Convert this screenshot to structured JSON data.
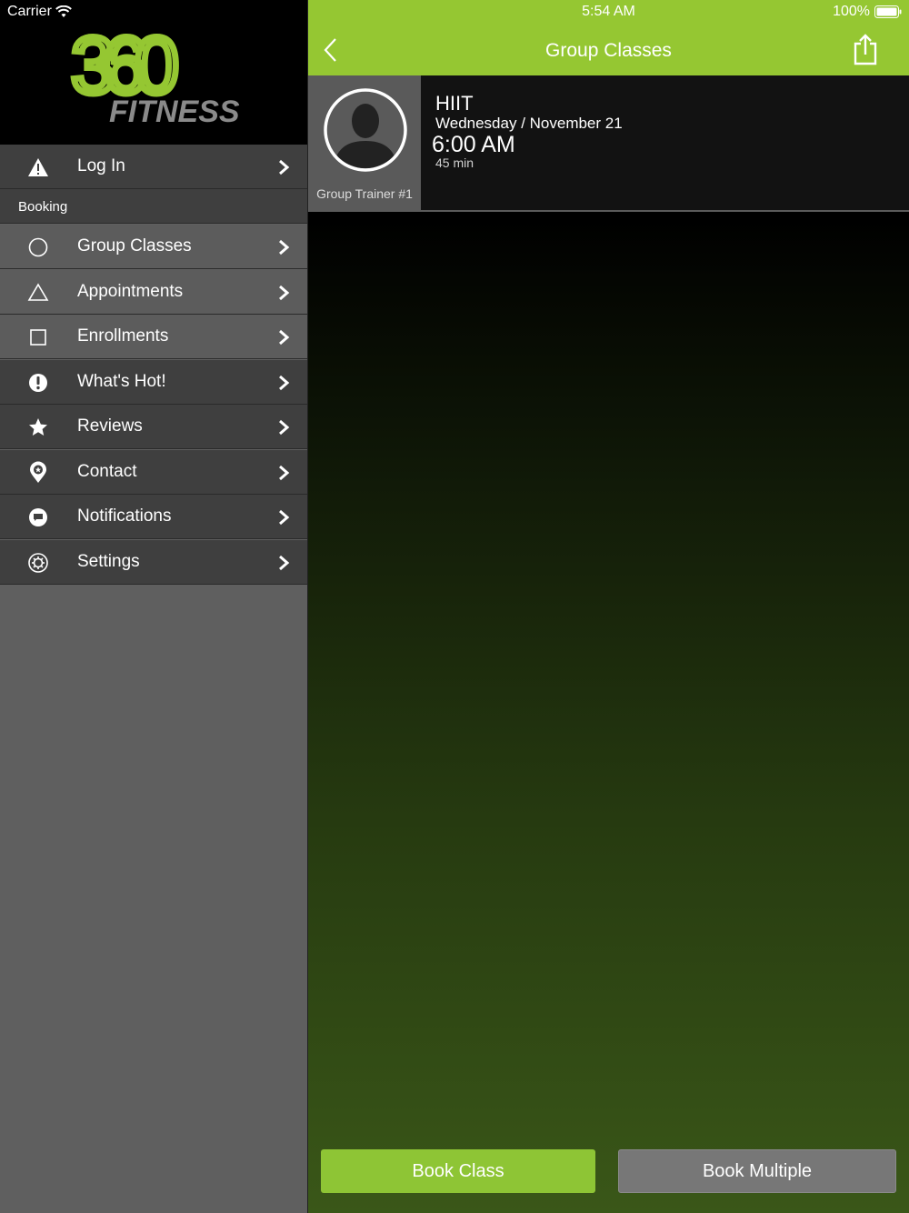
{
  "status_bar": {
    "carrier": "Carrier",
    "time": "5:54 AM",
    "battery": "100%"
  },
  "sidebar": {
    "logo_text_top": "360",
    "logo_text_bottom": "FITNESS",
    "login": {
      "label": "Log In",
      "icon": "warning-icon"
    },
    "section_header": "Booking",
    "items": [
      {
        "label": "Group Classes",
        "icon": "circle-icon"
      },
      {
        "label": "Appointments",
        "icon": "triangle-icon"
      },
      {
        "label": "Enrollments",
        "icon": "square-icon"
      },
      {
        "label": "What's Hot!",
        "icon": "exclamation-icon"
      },
      {
        "label": "Reviews",
        "icon": "star-icon"
      },
      {
        "label": "Contact",
        "icon": "location-pin-icon"
      },
      {
        "label": "Notifications",
        "icon": "chat-bubble-icon"
      },
      {
        "label": "Settings",
        "icon": "gear-icon"
      }
    ]
  },
  "header": {
    "title": "Group Classes"
  },
  "class": {
    "trainer": "Group Trainer #1",
    "name": "HIIT",
    "date": "Wednesday / November 21",
    "time": "6:00 AM",
    "duration": "45 min"
  },
  "actions": {
    "book_class": "Book Class",
    "book_multiple": "Book Multiple"
  },
  "colors": {
    "accent": "#95c732",
    "button_green": "#8ec535",
    "button_gray": "#777777"
  }
}
